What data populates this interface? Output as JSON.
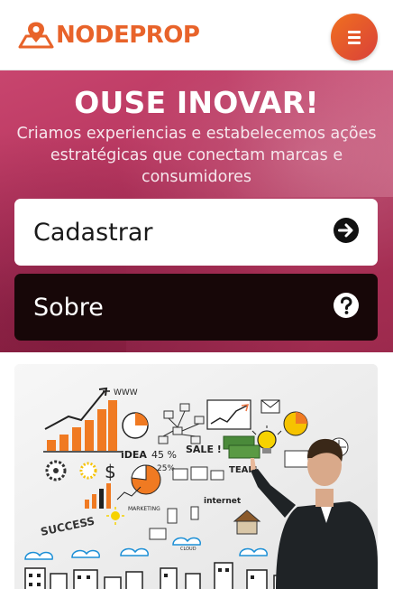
{
  "header": {
    "logo_text": "NODEPROP",
    "brand_color": "#e8632a",
    "menu_icon": "hamburger-menu-icon"
  },
  "hero": {
    "title": "OUSE INOVAR!",
    "subtitle": "Criamos experiencias e estabelecemos ações estratégicas que conectam marcas e consumidores",
    "register_label": "Cadastrar",
    "register_icon": "arrow-right-circle-icon",
    "about_label": "Sobre",
    "about_icon": "question-circle-icon"
  },
  "card": {
    "image_texts": {
      "www": "WWW",
      "idea": "iDEA",
      "percent45": "45 %",
      "sale": "SALE !",
      "percent25": "25%",
      "team": "TEAM",
      "internet": "internet",
      "success": "SUCCESS",
      "marketing": "MARKETING",
      "cloud": "CLOUD"
    }
  }
}
